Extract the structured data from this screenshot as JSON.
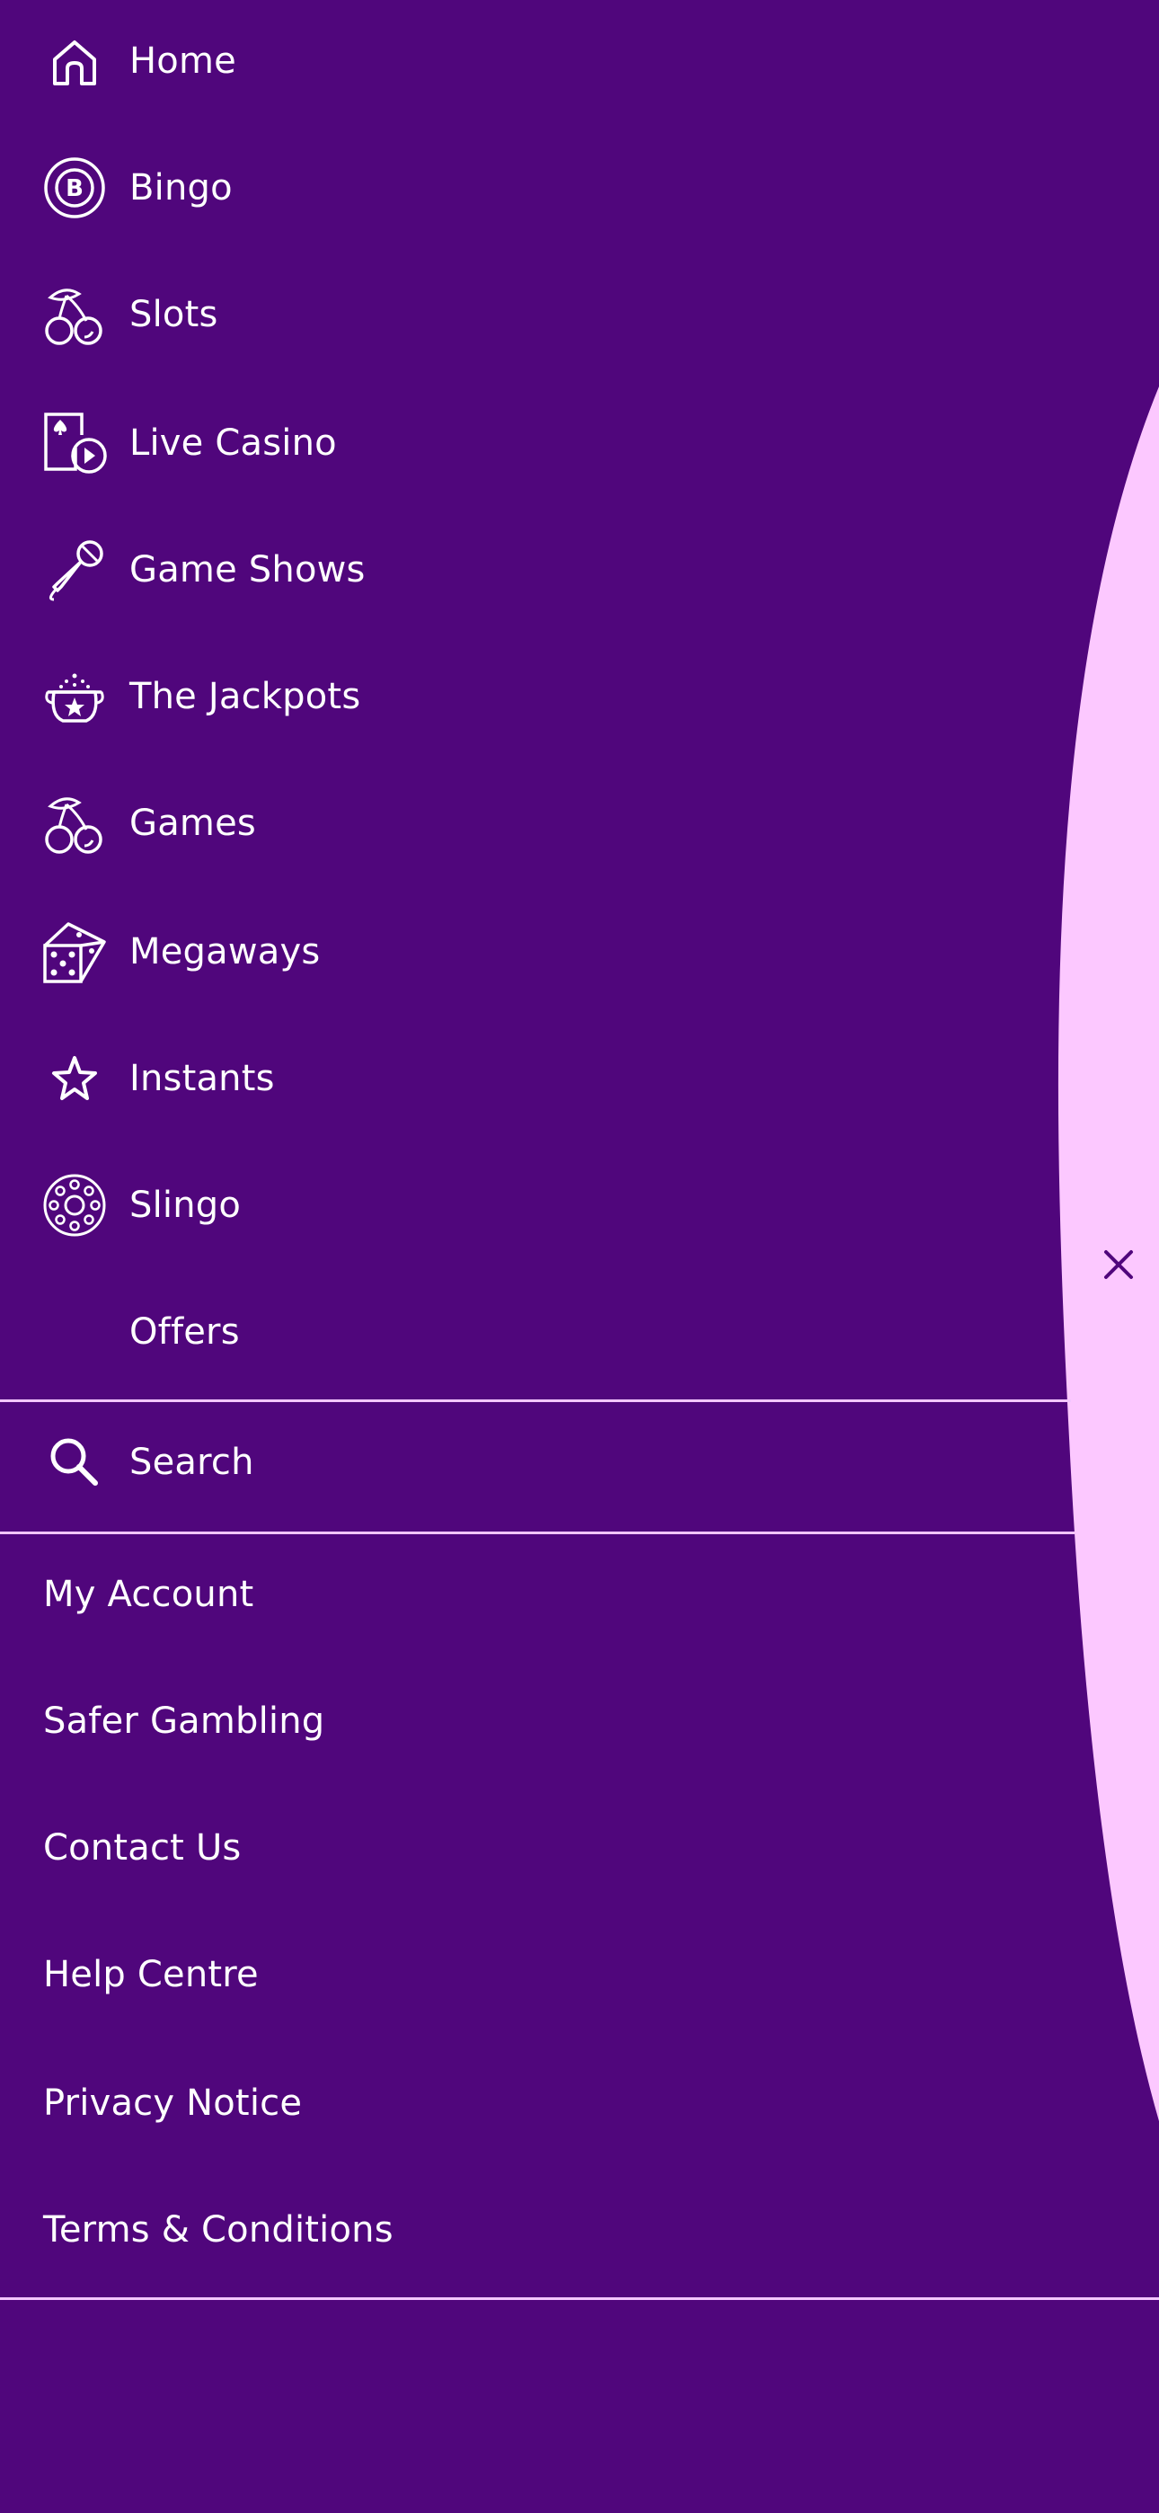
{
  "nav": {
    "items": [
      {
        "label": "Home",
        "icon": "home-icon"
      },
      {
        "label": "Bingo",
        "icon": "bingo-ball-icon"
      },
      {
        "label": "Slots",
        "icon": "cherries-icon"
      },
      {
        "label": "Live Casino",
        "icon": "live-casino-card-icon"
      },
      {
        "label": "Game Shows",
        "icon": "microphone-icon"
      },
      {
        "label": "The Jackpots",
        "icon": "jackpot-pot-icon"
      },
      {
        "label": "Games",
        "icon": "cherries-icon"
      },
      {
        "label": "Megaways",
        "icon": "dice-icon"
      },
      {
        "label": "Instants",
        "icon": "star-icon"
      },
      {
        "label": "Slingo",
        "icon": "slingo-icon"
      },
      {
        "label": "Offers",
        "icon": ""
      }
    ]
  },
  "search": {
    "label": "Search",
    "icon": "search-icon"
  },
  "footer": {
    "links": [
      {
        "label": "My Account"
      },
      {
        "label": "Safer Gambling"
      },
      {
        "label": "Contact Us"
      },
      {
        "label": "Help Centre"
      },
      {
        "label": "Privacy Notice"
      },
      {
        "label": "Terms & Conditions"
      }
    ]
  },
  "close": {
    "icon": "close-icon"
  },
  "colors": {
    "background": "#50067c",
    "accent_light": "#fcc8ff",
    "divider": "#f3c6ff",
    "text": "#ffffff"
  }
}
